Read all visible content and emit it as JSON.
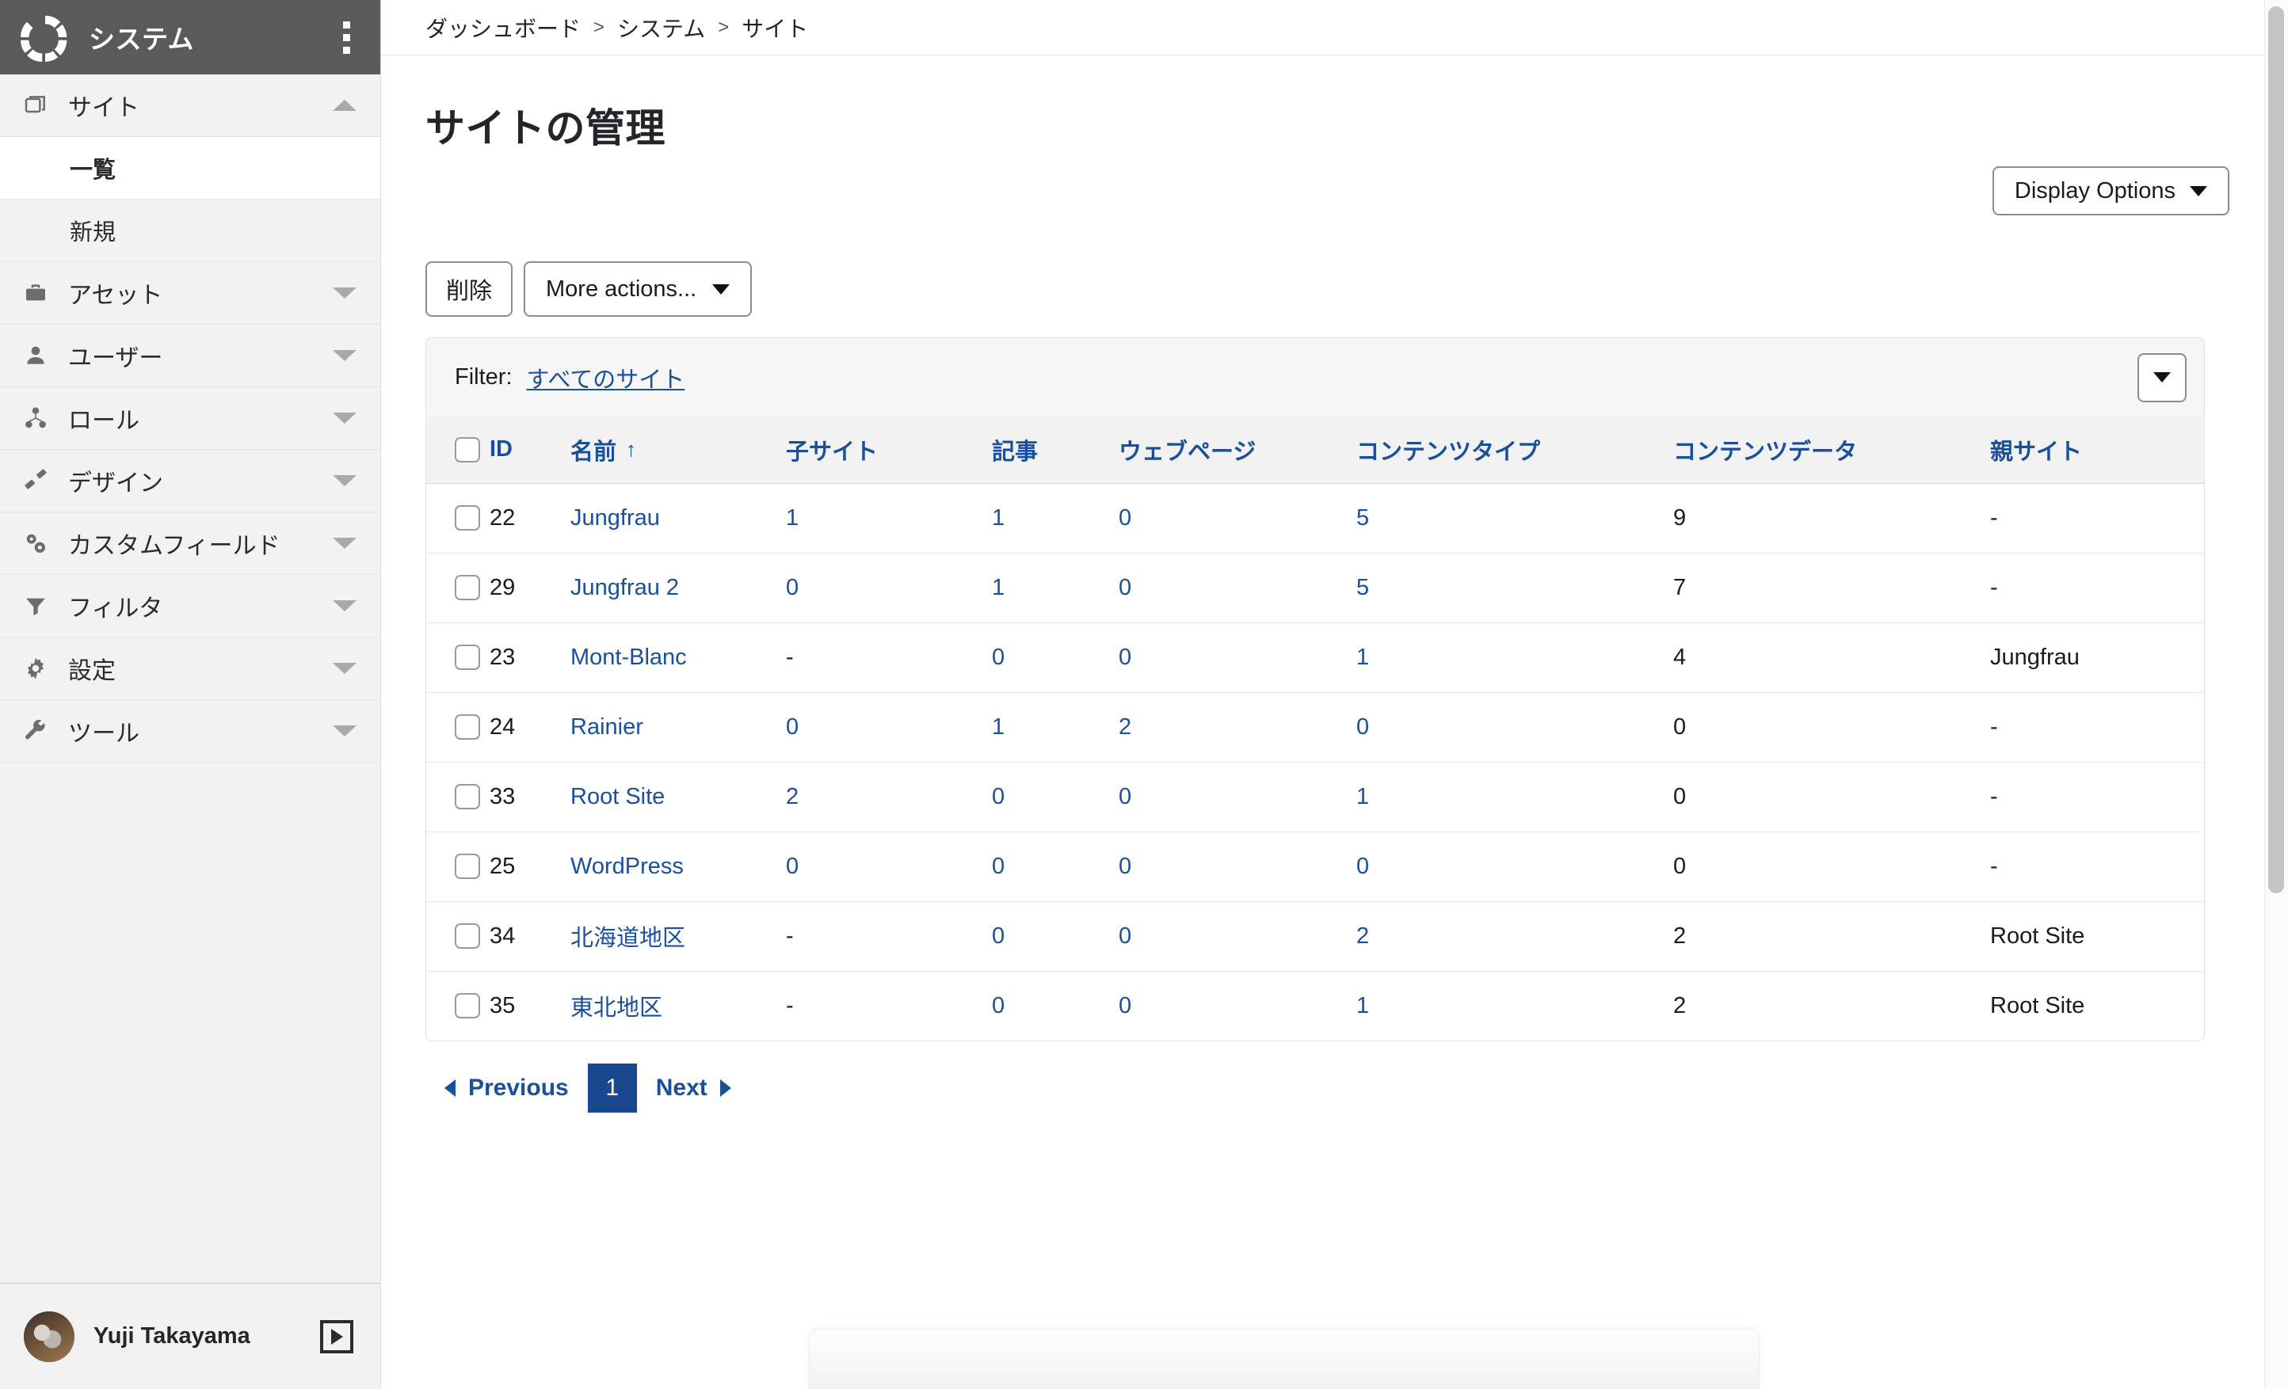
{
  "sidebar": {
    "brand": "システム",
    "logo_icon": "ring-logo-icon",
    "menu_icon": "kebab-menu-icon",
    "items": [
      {
        "label": "サイト",
        "icon": "sites-icon",
        "caret": "up",
        "expanded": true
      },
      {
        "label": "アセット",
        "icon": "briefcase-icon",
        "caret": "down",
        "expanded": false
      },
      {
        "label": "ユーザー",
        "icon": "user-icon",
        "caret": "down",
        "expanded": false
      },
      {
        "label": "ロール",
        "icon": "roles-icon",
        "caret": "down",
        "expanded": false
      },
      {
        "label": "デザイン",
        "icon": "design-icon",
        "caret": "down",
        "expanded": false
      },
      {
        "label": "カスタムフィールド",
        "icon": "custom-fields-icon",
        "caret": "down",
        "expanded": false
      },
      {
        "label": "フィルタ",
        "icon": "filter-icon",
        "caret": "down",
        "expanded": false
      },
      {
        "label": "設定",
        "icon": "gear-icon",
        "caret": "down",
        "expanded": false
      },
      {
        "label": "ツール",
        "icon": "wrench-icon",
        "caret": "down",
        "expanded": false
      }
    ],
    "subitems": [
      {
        "label": "一覧",
        "active": true
      },
      {
        "label": "新規",
        "active": false
      }
    ],
    "footer": {
      "user_name": "Yuji Takayama",
      "avatar_icon": "user-avatar",
      "collapse_icon": "collapse-panel-icon"
    }
  },
  "breadcrumb": {
    "items": [
      "ダッシュボード",
      "システム",
      "サイト"
    ],
    "separator": ">"
  },
  "header": {
    "title": "サイトの管理"
  },
  "toolbar": {
    "display_options_label": "Display Options",
    "delete_label": "削除",
    "more_actions_label": "More actions..."
  },
  "filter": {
    "label": "Filter:",
    "value": "すべてのサイト",
    "caret_icon": "chevron-down-icon"
  },
  "table": {
    "select_all_checked": false,
    "sort_column": "名前",
    "sort_direction": "↑",
    "columns": [
      "ID",
      "名前",
      "子サイト",
      "記事",
      "ウェブページ",
      "コンテンツタイプ",
      "コンテンツデータ",
      "親サイト"
    ],
    "rows": [
      {
        "id": "22",
        "name": "Jungfrau",
        "child_sites": "1",
        "articles": "1",
        "webpages": "0",
        "content_types": "5",
        "content_data": "9",
        "parent": "-"
      },
      {
        "id": "29",
        "name": "Jungfrau 2",
        "child_sites": "0",
        "articles": "1",
        "webpages": "0",
        "content_types": "5",
        "content_data": "7",
        "parent": "-"
      },
      {
        "id": "23",
        "name": "Mont-Blanc",
        "child_sites": "-",
        "articles": "0",
        "webpages": "0",
        "content_types": "1",
        "content_data": "4",
        "parent": "Jungfrau"
      },
      {
        "id": "24",
        "name": "Rainier",
        "child_sites": "0",
        "articles": "1",
        "webpages": "2",
        "content_types": "0",
        "content_data": "0",
        "parent": "-"
      },
      {
        "id": "33",
        "name": "Root Site",
        "child_sites": "2",
        "articles": "0",
        "webpages": "0",
        "content_types": "1",
        "content_data": "0",
        "parent": "-"
      },
      {
        "id": "25",
        "name": "WordPress",
        "child_sites": "0",
        "articles": "0",
        "webpages": "0",
        "content_types": "0",
        "content_data": "0",
        "parent": "-"
      },
      {
        "id": "34",
        "name": "北海道地区",
        "child_sites": "-",
        "articles": "0",
        "webpages": "0",
        "content_types": "2",
        "content_data": "2",
        "parent": "Root Site"
      },
      {
        "id": "35",
        "name": "東北地区",
        "child_sites": "-",
        "articles": "0",
        "webpages": "0",
        "content_types": "1",
        "content_data": "2",
        "parent": "Root Site"
      }
    ]
  },
  "pagination": {
    "previous_label": "Previous",
    "next_label": "Next",
    "pages": [
      "1"
    ],
    "current_page": "1"
  },
  "colors": {
    "link": "#1a4f9c",
    "accent": "#19488f",
    "sidebar_header_bg": "#5a5a5a",
    "sidebar_bg": "#f2f2f2"
  }
}
